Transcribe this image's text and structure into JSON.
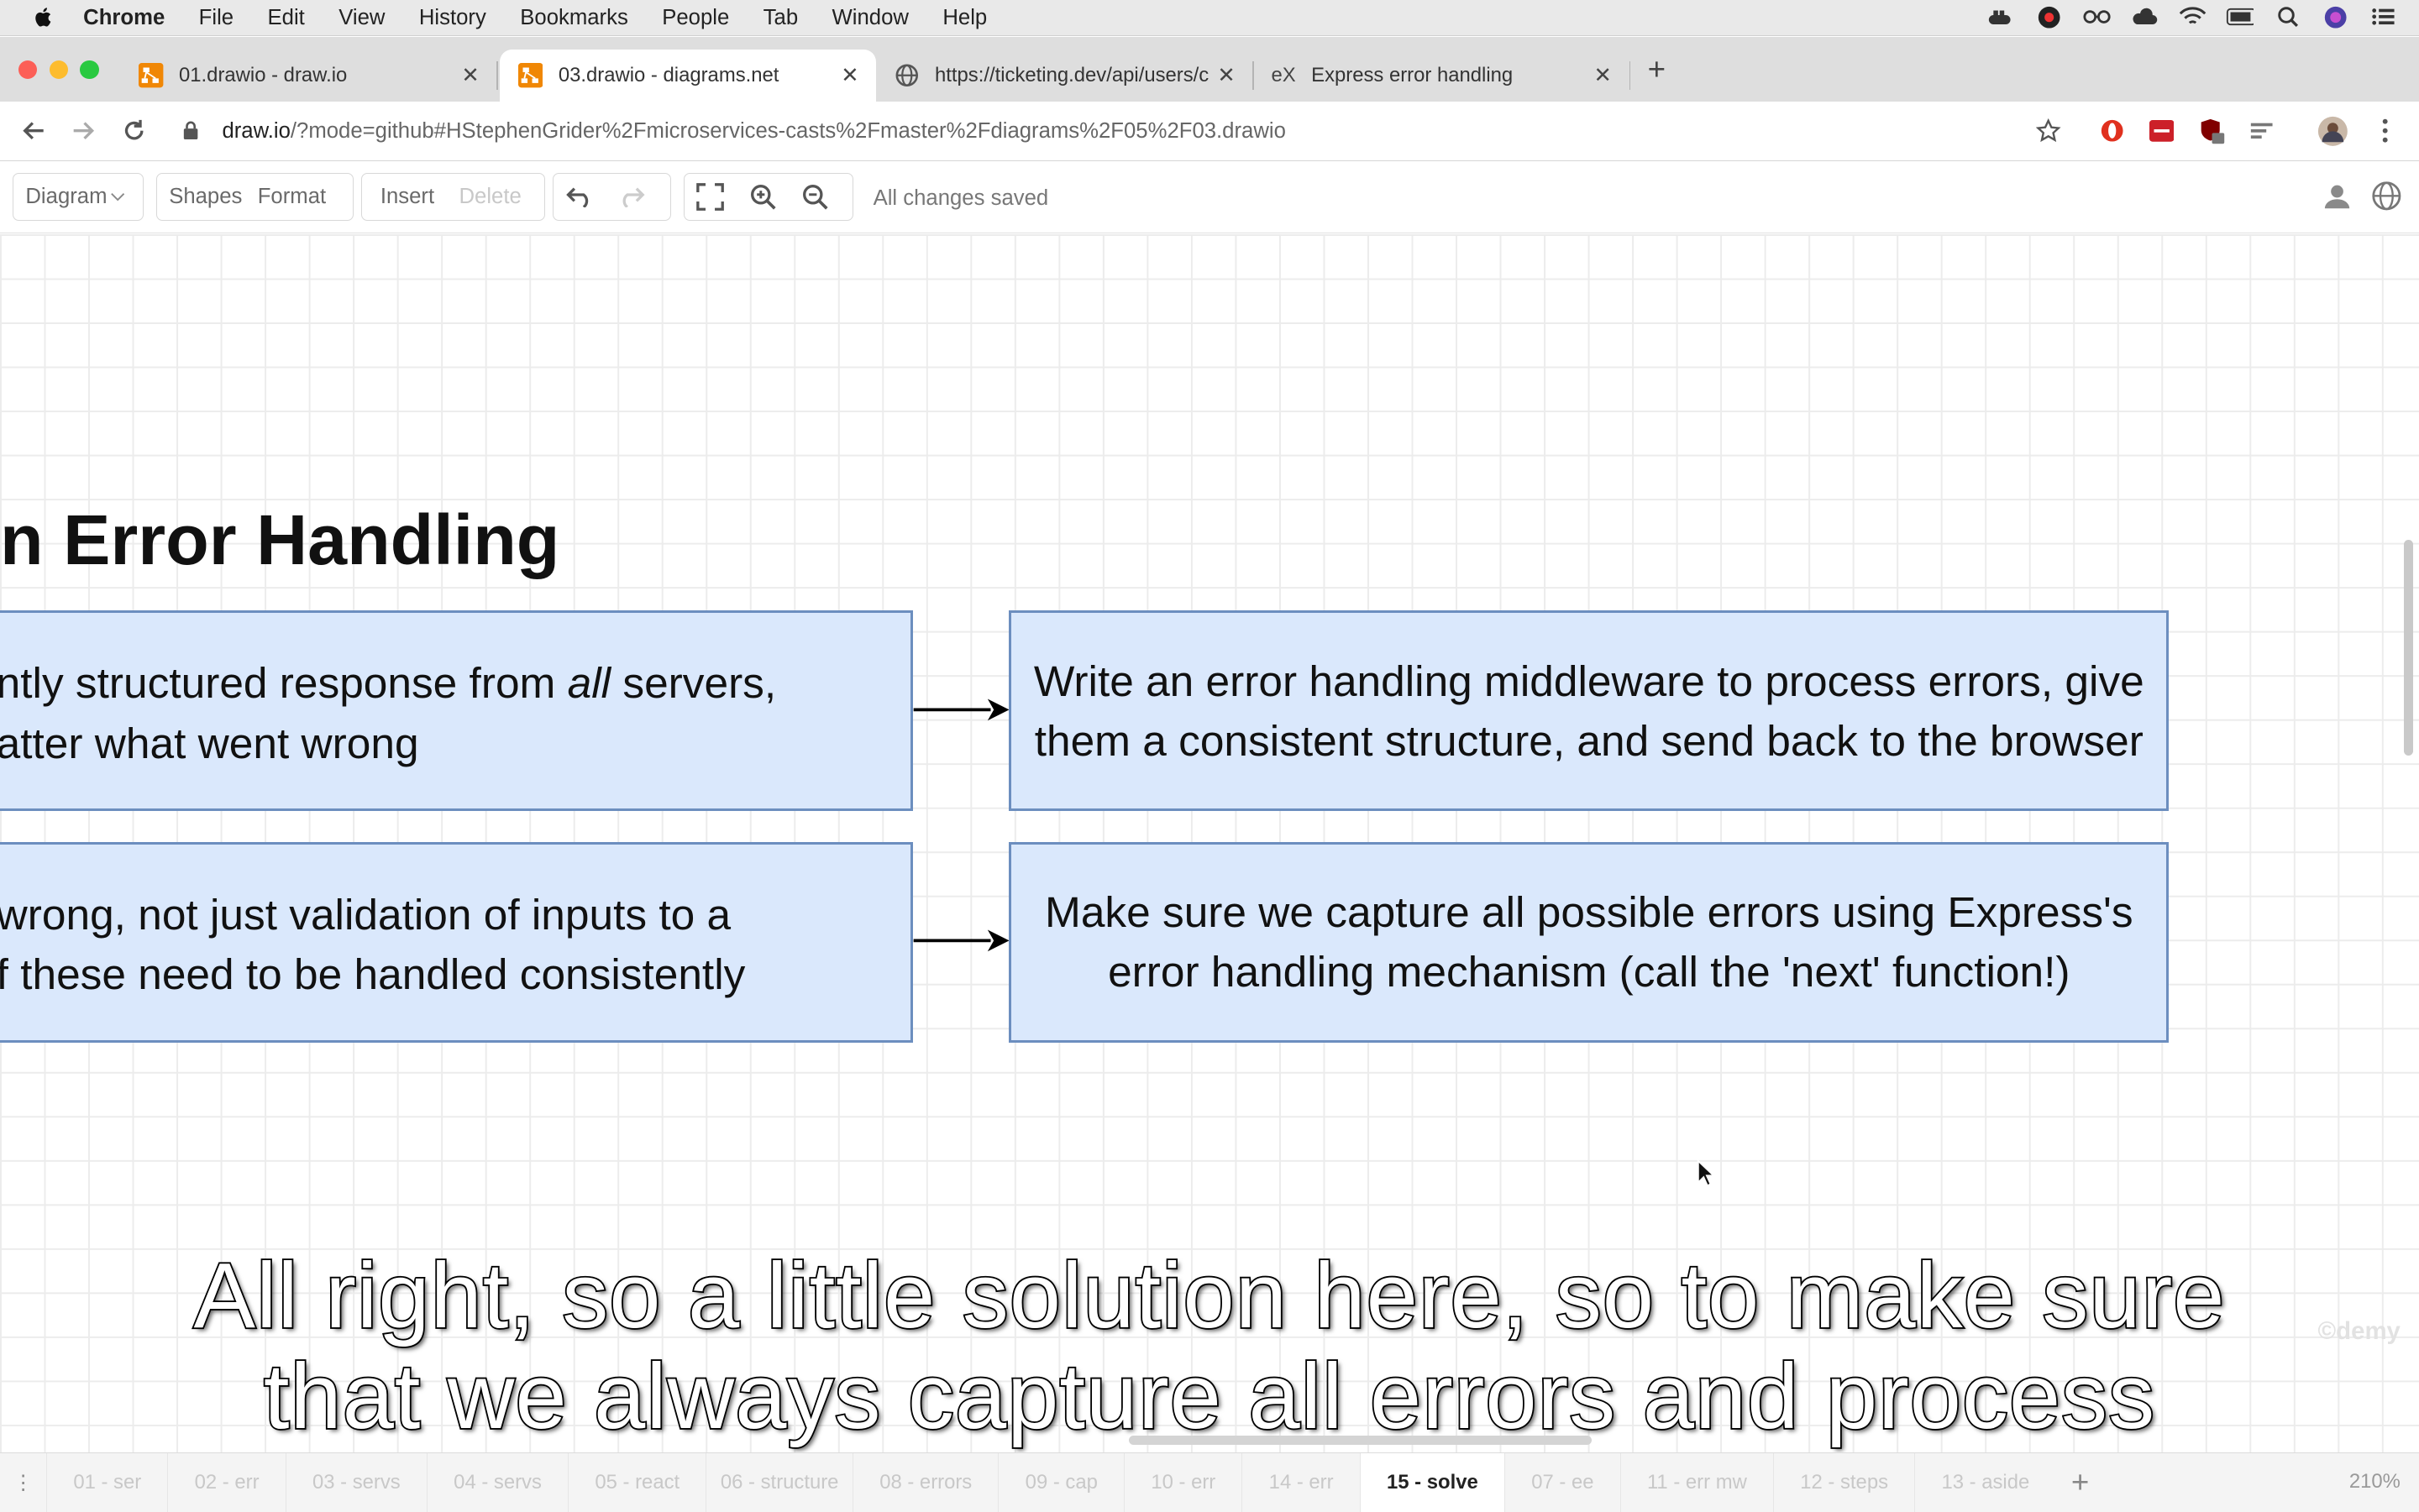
{
  "menubar": {
    "app": "Chrome",
    "items": [
      "File",
      "Edit",
      "View",
      "History",
      "Bookmarks",
      "People",
      "Tab",
      "Window",
      "Help"
    ]
  },
  "browser_tabs": [
    {
      "title": "01.drawio - draw.io",
      "icon": "drawio-icon",
      "active": false
    },
    {
      "title": "03.drawio - diagrams.net",
      "icon": "drawio-icon",
      "active": true
    },
    {
      "title": "https://ticketing.dev/api/users/c",
      "icon": "globe-icon",
      "active": false
    },
    {
      "title": "Express error handling",
      "icon": "ex-icon",
      "active": false
    }
  ],
  "address": {
    "host": "draw.io",
    "path": "/?mode=github#HStephenGrider%2Fmicroservices-casts%2Fmaster%2Fdiagrams%2F05%2F03.drawio"
  },
  "drawio_toolbar": {
    "diagram": "Diagram",
    "shapes": "Shapes",
    "format": "Format",
    "insert": "Insert",
    "delete": "Delete",
    "status": "All changes saved"
  },
  "diagram": {
    "heading": "n Error Handling",
    "rows": [
      {
        "left_lines": [
          "ntly structured response from ",
          "all",
          " servers,",
          "atter what went wrong"
        ],
        "right_text": "Write an error handling middleware to process errors, give them a consistent structure, and send back to the browser"
      },
      {
        "left_lines": [
          "wrong, not just validation of inputs to a",
          "f these need to be handled consistently"
        ],
        "right_text": "Make sure we capture all possible errors using Express's error handling mechanism (call the 'next' function!)"
      }
    ],
    "watermark": "©demy"
  },
  "subtitle": {
    "line1": "All right, so a little solution here, so to make sure",
    "line2": "that we always capture all errors and process"
  },
  "page_tabs": [
    {
      "label": "01 - ser",
      "active": false
    },
    {
      "label": "02 - err",
      "active": false
    },
    {
      "label": "03 - servs",
      "active": false
    },
    {
      "label": "04 - servs",
      "active": false
    },
    {
      "label": "05 - react",
      "active": false
    },
    {
      "label": "06 - structure",
      "active": false
    },
    {
      "label": "08 - errors",
      "active": false
    },
    {
      "label": "09 - cap",
      "active": false
    },
    {
      "label": "10 - err",
      "active": false
    },
    {
      "label": "14 - err",
      "active": false
    },
    {
      "label": "15 - solve",
      "active": true
    },
    {
      "label": "07 - ee",
      "active": false
    },
    {
      "label": "11 - err mw",
      "active": false
    },
    {
      "label": "12 - steps",
      "active": false
    },
    {
      "label": "13 - aside",
      "active": false
    }
  ],
  "zoom": "210%",
  "colors": {
    "box_fill": "#dae8fc",
    "box_stroke": "#6c8ebf"
  }
}
